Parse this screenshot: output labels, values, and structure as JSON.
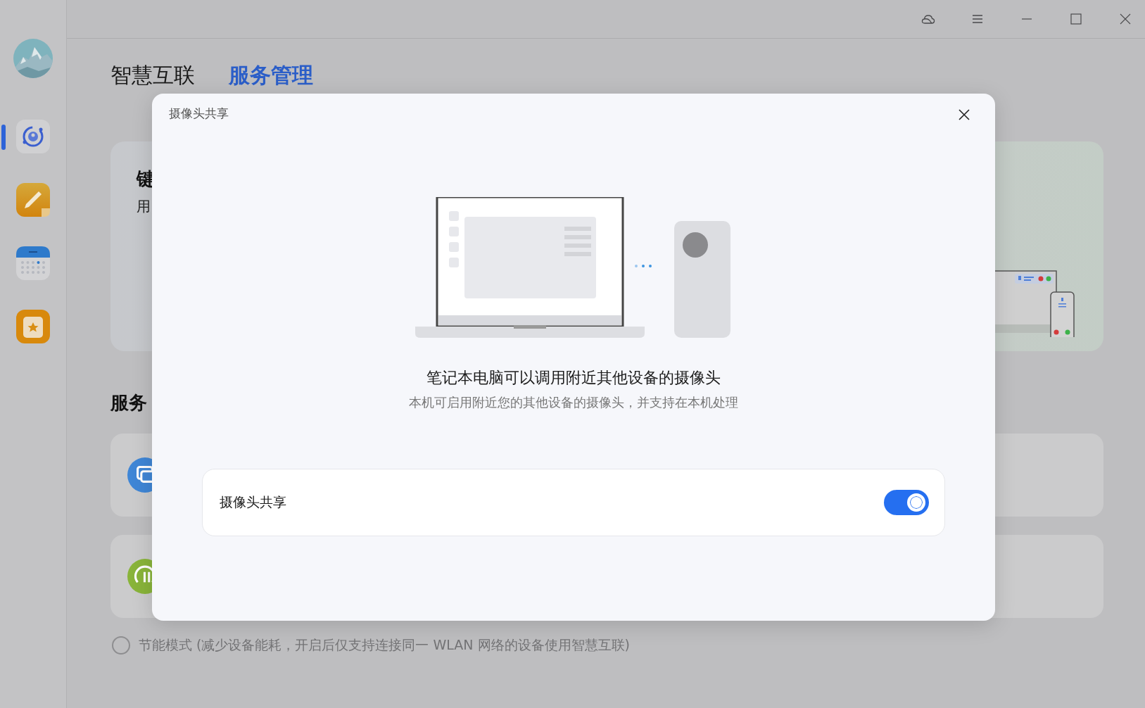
{
  "sidebar": {
    "items": [
      {
        "kind": "connect",
        "selected": true
      },
      {
        "kind": "notes",
        "selected": false
      },
      {
        "kind": "calendar",
        "selected": false
      },
      {
        "kind": "favorites",
        "selected": false
      }
    ]
  },
  "tabs": [
    {
      "label": "智慧互联",
      "selected": false
    },
    {
      "label": "服务管理",
      "selected": true
    }
  ],
  "feature_card": {
    "title": "键",
    "text": "用"
  },
  "section_title": "服务",
  "service_cards": [
    {
      "kind": "screen"
    },
    {
      "kind": "signal"
    }
  ],
  "energy_saving": {
    "label": "节能模式 (减少设备能耗，开启后仅支持连接同一 WLAN 网络的设备使用智慧互联)",
    "checked": false
  },
  "dialog": {
    "title": "摄像头共享",
    "heading": "笔记本电脑可以调用附近其他设备的摄像头",
    "description": "本机可启用附近您的其他设备的摄像头，并支持在本机处理",
    "setting": {
      "label": "摄像头共享",
      "on": true
    }
  }
}
